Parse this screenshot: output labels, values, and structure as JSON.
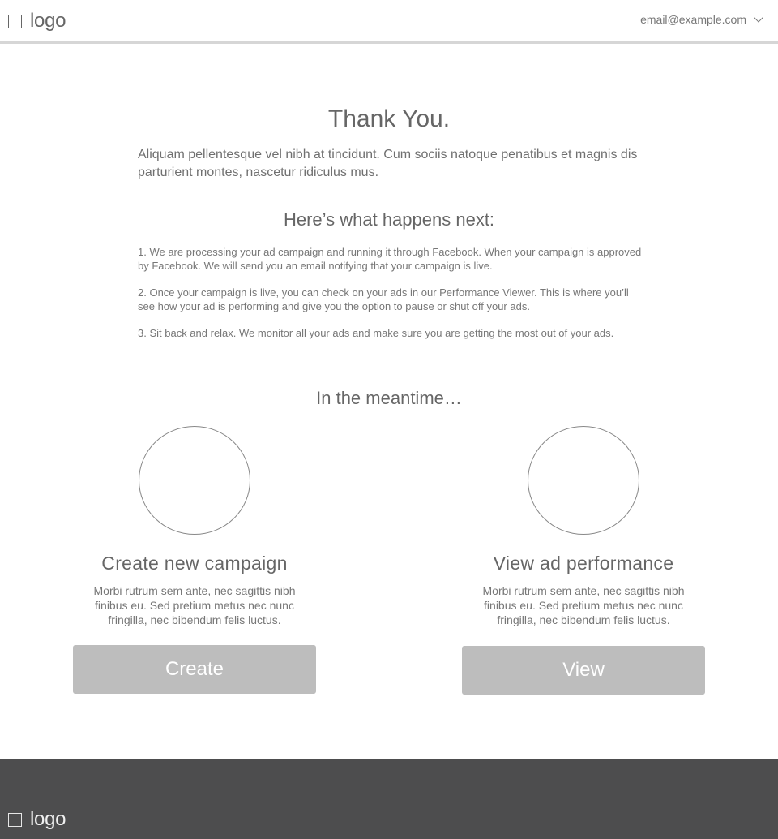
{
  "header": {
    "logo_text": "logo",
    "account_email": "email@example.com"
  },
  "main": {
    "title": "Thank You.",
    "intro": "Aliquam pellentesque vel nibh at tincidunt. Cum sociis natoque penatibus et magnis dis parturient montes, nascetur ridiculus mus.",
    "next_heading": "Here’s what happens next:",
    "steps": [
      "1. We are processing your ad campaign and running it through Facebook. When your campaign is approved by Facebook. We will send you an email notifying that your campaign is live.",
      "2. Once your campaign is live, you can check on your ads in our Performance Viewer. This is where you’ll see how your ad is performing and give you the option to pause or shut off your ads.",
      "3. Sit back and relax. We monitor all your ads and make sure you are getting the most out of your ads."
    ],
    "meantime_heading": "In the meantime…",
    "cards": [
      {
        "title": "Create new campaign",
        "description": "Morbi rutrum sem ante, nec sagittis nibh finibus eu. Sed pretium metus nec nunc fringilla, nec bibendum felis luctus.",
        "button_label": "Create"
      },
      {
        "title": "View ad performance",
        "description": "Morbi rutrum sem ante, nec sagittis nibh finibus eu. Sed pretium metus nec nunc fringilla, nec bibendum felis luctus.",
        "button_label": "View"
      }
    ]
  },
  "footer": {
    "logo_text": "logo"
  },
  "colors": {
    "button_background": "#bdbdbd",
    "footer_background": "#4d4d4e",
    "header_border": "#d6d6d6"
  },
  "icons": {
    "header_logo": "logo-placeholder-icon",
    "account_menu": "chevron-down-icon",
    "card_images": "circle-image-placeholder"
  }
}
